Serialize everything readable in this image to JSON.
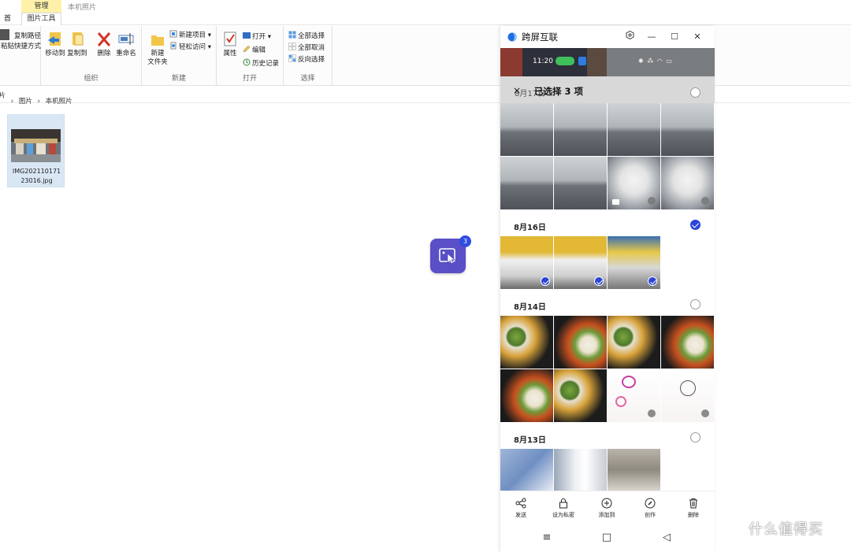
{
  "explorer": {
    "title_context_tab": "管理",
    "window_title": "本机照片",
    "home_tab_fragment": "首页",
    "picture_tools_tab": "图片工具",
    "clipboard_fragments": [
      "复制路径",
      "粘贴快捷方式"
    ],
    "organize": {
      "move_to": "移动到",
      "copy_to": "复制到",
      "delete": "删除",
      "rename": "重命名",
      "caption": "组织"
    },
    "new": {
      "new_folder": "新建\n文件夹",
      "new_item": "新建项目",
      "easy_access": "轻松访问",
      "caption": "新建"
    },
    "open": {
      "properties": "属性",
      "open": "打开",
      "edit": "编辑",
      "history": "历史记录",
      "caption": "打开"
    },
    "select": {
      "select_all": "全部选择",
      "select_none": "全部取消",
      "invert": "反向选择",
      "caption": "选择"
    },
    "breadcrumb": [
      "片",
      "图片",
      "本机照片"
    ],
    "file": {
      "name": "IMG20211017123016.jpg",
      "name_line1": "IMG202110171",
      "name_line2": "23016.jpg"
    }
  },
  "drag_badge": {
    "count": "3"
  },
  "phone": {
    "app_title": "跨屏互联",
    "status_time": "11:20",
    "status_icons": "✱ ⁂ ◠ ▭",
    "selection_close": "×",
    "selection_text": "已选择 3 项",
    "selection_date_peek": "8月17日",
    "groups": [
      {
        "date": "8月17日",
        "checked": false
      },
      {
        "date": "8月16日",
        "checked": true
      },
      {
        "date": "8月14日",
        "checked": false
      },
      {
        "date": "8月13日",
        "checked": false
      }
    ],
    "actions": [
      "发送",
      "设为私密",
      "添加到",
      "创作",
      "删除"
    ],
    "nav": {
      "menu": "≡",
      "home": "□",
      "back": "◁"
    }
  },
  "watermark": {
    "text": "什么值得买"
  },
  "colors": {
    "accent": "#2c45d6",
    "drag_bubble": "#5a4fc6",
    "manage_tab": "#fff2a8",
    "selection_bar": "#d8d8d8"
  }
}
